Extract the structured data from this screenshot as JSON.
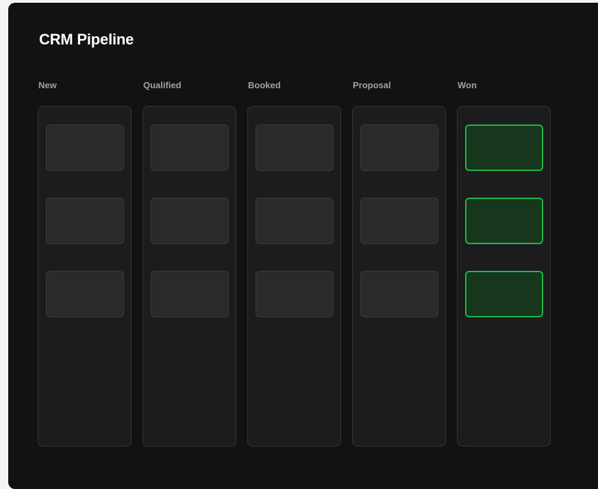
{
  "page": {
    "title": "CRM Pipeline"
  },
  "colors": {
    "panel_bg": "#121212",
    "lane_bg": "#1c1c1c",
    "card_bg": "#2a2a2a",
    "won_card_bg": "#16361d",
    "won_accent": "#22b64a"
  },
  "pipeline": {
    "columns": [
      {
        "label": "New",
        "card_count": 3
      },
      {
        "label": "Qualified",
        "card_count": 3
      },
      {
        "label": "Booked",
        "card_count": 3
      },
      {
        "label": "Proposal",
        "card_count": 3
      },
      {
        "label": "Won",
        "card_count": 3
      }
    ]
  }
}
